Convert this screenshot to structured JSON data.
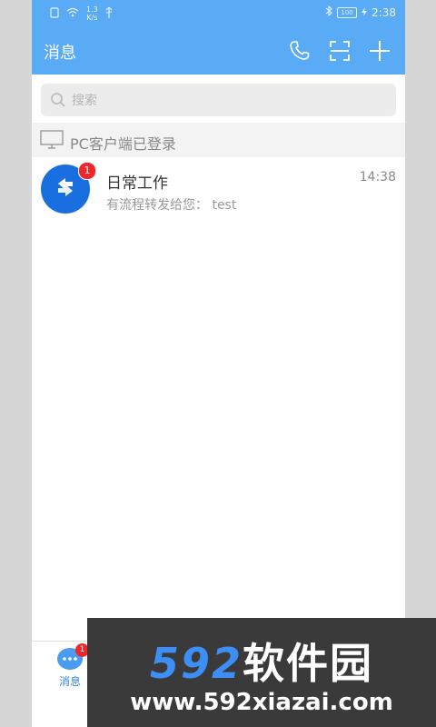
{
  "status_bar": {
    "net_speed_value": "1.3",
    "net_speed_unit": "K/s",
    "battery": "100",
    "time": "2:38"
  },
  "app_bar": {
    "title": "消息",
    "actions": [
      "phone-icon",
      "scan-icon",
      "plus-icon"
    ]
  },
  "search": {
    "placeholder": "搜索",
    "value": ""
  },
  "pc_status": {
    "text": "PC客户端已登录"
  },
  "conversations": [
    {
      "name": "日常工作",
      "time": "14:38",
      "preview": "有流程转发给您： test",
      "unread": "1",
      "avatar_icon": "workflow-icon",
      "avatar_color": "#1a6fe0"
    }
  ],
  "bottom_nav": {
    "items": [
      {
        "label": "消息",
        "badge": "1",
        "icon": "chat-bubble-icon"
      }
    ]
  },
  "watermark": {
    "logo_num": "592",
    "logo_cn": "软件园",
    "url": "www.592xiazai.com"
  },
  "colors": {
    "primary": "#5aabf5",
    "badge": "#f2252a",
    "nav_active": "#2f86e8"
  }
}
